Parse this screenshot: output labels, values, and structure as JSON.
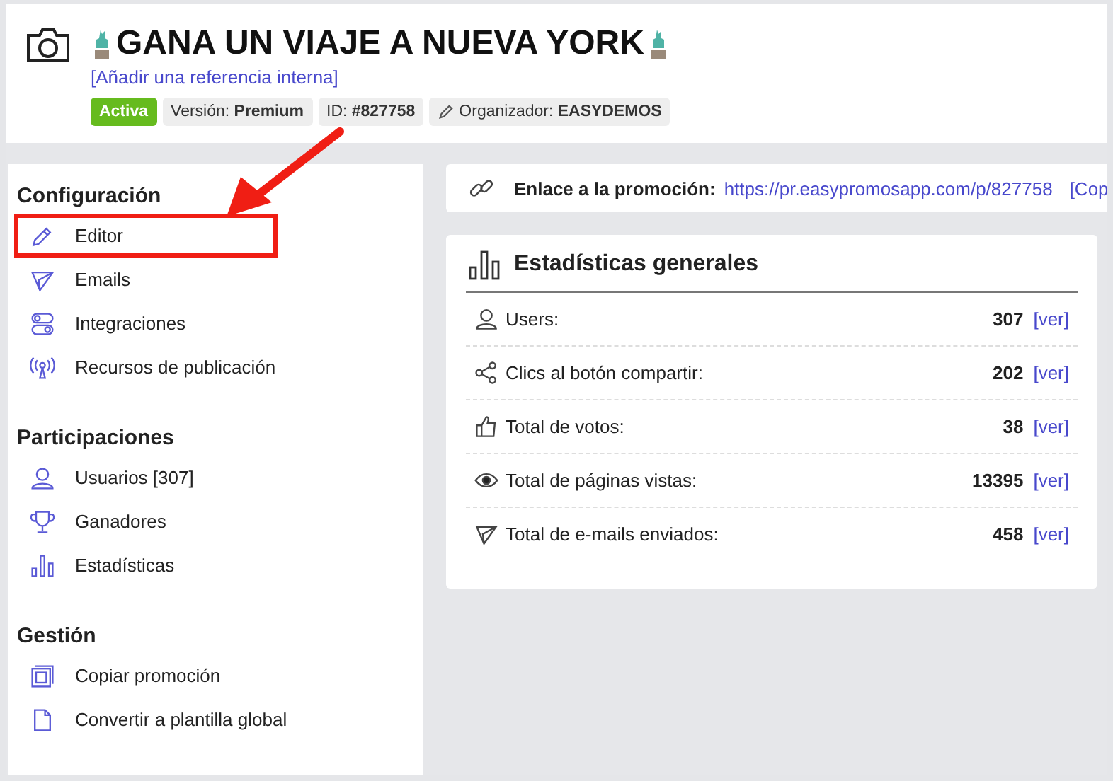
{
  "header": {
    "title": "GANA UN VIAJE A NUEVA YORK",
    "reference_link": "[Añadir una referencia interna]",
    "tags": [
      {
        "kind": "status",
        "text": "Activa"
      },
      {
        "kind": "plain",
        "text": "Versión: **Premium**"
      },
      {
        "kind": "plain",
        "text": "ID: **#827758**"
      },
      {
        "kind": "organizer",
        "text": "Organizador: **EASYDEMOS**"
      }
    ]
  },
  "sidebar": {
    "sections": [
      {
        "title": "Configuración",
        "items": [
          {
            "label": "Editor",
            "highlighted": true
          },
          {
            "label": "Emails",
            "highlighted": false
          },
          {
            "label": "Integraciones",
            "highlighted": false
          },
          {
            "label": "Recursos de publicación",
            "highlighted": false
          }
        ]
      },
      {
        "title": "Participaciones",
        "items": [
          {
            "label": "Usuarios [307]",
            "highlighted": false
          },
          {
            "label": "Ganadores",
            "highlighted": false
          },
          {
            "label": "Estadísticas",
            "highlighted": false
          }
        ]
      },
      {
        "title": "Gestión",
        "items": [
          {
            "label": "Copiar promoción",
            "highlighted": false
          },
          {
            "label": "Convertir a plantilla global",
            "highlighted": false
          }
        ]
      }
    ]
  },
  "promo_link": {
    "label": "Enlace a la promoción:",
    "url": "https://pr.easypromosapp.com/p/827758",
    "copy": "[Cop"
  },
  "stats": {
    "title": "Estadísticas generales",
    "rows": [
      {
        "label": "Users:",
        "value": "307",
        "link": "[ver]"
      },
      {
        "label": "Clics al botón compartir:",
        "value": "202",
        "link": "[ver]"
      },
      {
        "label": "Total de votos:",
        "value": "38",
        "link": "[ver]"
      },
      {
        "label": "Total de páginas vistas:",
        "value": "13395",
        "link": "[ver]"
      },
      {
        "label": "Total de e-mails enviados:",
        "value": "458",
        "link": "[ver]"
      }
    ]
  }
}
